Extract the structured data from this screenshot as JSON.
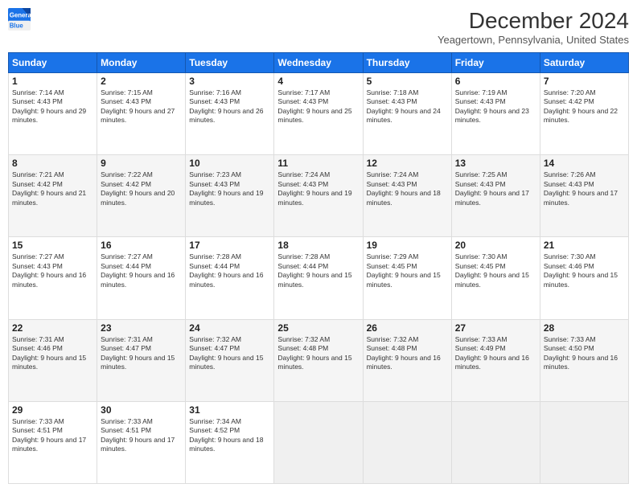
{
  "logo": {
    "general": "General",
    "blue": "Blue"
  },
  "title": "December 2024",
  "location": "Yeagertown, Pennsylvania, United States",
  "days_of_week": [
    "Sunday",
    "Monday",
    "Tuesday",
    "Wednesday",
    "Thursday",
    "Friday",
    "Saturday"
  ],
  "weeks": [
    [
      {
        "day": "1",
        "sunrise": "7:14 AM",
        "sunset": "4:43 PM",
        "daylight": "9 hours and 29 minutes."
      },
      {
        "day": "2",
        "sunrise": "7:15 AM",
        "sunset": "4:43 PM",
        "daylight": "9 hours and 27 minutes."
      },
      {
        "day": "3",
        "sunrise": "7:16 AM",
        "sunset": "4:43 PM",
        "daylight": "9 hours and 26 minutes."
      },
      {
        "day": "4",
        "sunrise": "7:17 AM",
        "sunset": "4:43 PM",
        "daylight": "9 hours and 25 minutes."
      },
      {
        "day": "5",
        "sunrise": "7:18 AM",
        "sunset": "4:43 PM",
        "daylight": "9 hours and 24 minutes."
      },
      {
        "day": "6",
        "sunrise": "7:19 AM",
        "sunset": "4:43 PM",
        "daylight": "9 hours and 23 minutes."
      },
      {
        "day": "7",
        "sunrise": "7:20 AM",
        "sunset": "4:42 PM",
        "daylight": "9 hours and 22 minutes."
      }
    ],
    [
      {
        "day": "8",
        "sunrise": "7:21 AM",
        "sunset": "4:42 PM",
        "daylight": "9 hours and 21 minutes."
      },
      {
        "day": "9",
        "sunrise": "7:22 AM",
        "sunset": "4:42 PM",
        "daylight": "9 hours and 20 minutes."
      },
      {
        "day": "10",
        "sunrise": "7:23 AM",
        "sunset": "4:43 PM",
        "daylight": "9 hours and 19 minutes."
      },
      {
        "day": "11",
        "sunrise": "7:24 AM",
        "sunset": "4:43 PM",
        "daylight": "9 hours and 19 minutes."
      },
      {
        "day": "12",
        "sunrise": "7:24 AM",
        "sunset": "4:43 PM",
        "daylight": "9 hours and 18 minutes."
      },
      {
        "day": "13",
        "sunrise": "7:25 AM",
        "sunset": "4:43 PM",
        "daylight": "9 hours and 17 minutes."
      },
      {
        "day": "14",
        "sunrise": "7:26 AM",
        "sunset": "4:43 PM",
        "daylight": "9 hours and 17 minutes."
      }
    ],
    [
      {
        "day": "15",
        "sunrise": "7:27 AM",
        "sunset": "4:43 PM",
        "daylight": "9 hours and 16 minutes."
      },
      {
        "day": "16",
        "sunrise": "7:27 AM",
        "sunset": "4:44 PM",
        "daylight": "9 hours and 16 minutes."
      },
      {
        "day": "17",
        "sunrise": "7:28 AM",
        "sunset": "4:44 PM",
        "daylight": "9 hours and 16 minutes."
      },
      {
        "day": "18",
        "sunrise": "7:28 AM",
        "sunset": "4:44 PM",
        "daylight": "9 hours and 15 minutes."
      },
      {
        "day": "19",
        "sunrise": "7:29 AM",
        "sunset": "4:45 PM",
        "daylight": "9 hours and 15 minutes."
      },
      {
        "day": "20",
        "sunrise": "7:30 AM",
        "sunset": "4:45 PM",
        "daylight": "9 hours and 15 minutes."
      },
      {
        "day": "21",
        "sunrise": "7:30 AM",
        "sunset": "4:46 PM",
        "daylight": "9 hours and 15 minutes."
      }
    ],
    [
      {
        "day": "22",
        "sunrise": "7:31 AM",
        "sunset": "4:46 PM",
        "daylight": "9 hours and 15 minutes."
      },
      {
        "day": "23",
        "sunrise": "7:31 AM",
        "sunset": "4:47 PM",
        "daylight": "9 hours and 15 minutes."
      },
      {
        "day": "24",
        "sunrise": "7:32 AM",
        "sunset": "4:47 PM",
        "daylight": "9 hours and 15 minutes."
      },
      {
        "day": "25",
        "sunrise": "7:32 AM",
        "sunset": "4:48 PM",
        "daylight": "9 hours and 15 minutes."
      },
      {
        "day": "26",
        "sunrise": "7:32 AM",
        "sunset": "4:48 PM",
        "daylight": "9 hours and 16 minutes."
      },
      {
        "day": "27",
        "sunrise": "7:33 AM",
        "sunset": "4:49 PM",
        "daylight": "9 hours and 16 minutes."
      },
      {
        "day": "28",
        "sunrise": "7:33 AM",
        "sunset": "4:50 PM",
        "daylight": "9 hours and 16 minutes."
      }
    ],
    [
      {
        "day": "29",
        "sunrise": "7:33 AM",
        "sunset": "4:51 PM",
        "daylight": "9 hours and 17 minutes."
      },
      {
        "day": "30",
        "sunrise": "7:33 AM",
        "sunset": "4:51 PM",
        "daylight": "9 hours and 17 minutes."
      },
      {
        "day": "31",
        "sunrise": "7:34 AM",
        "sunset": "4:52 PM",
        "daylight": "9 hours and 18 minutes."
      },
      null,
      null,
      null,
      null
    ]
  ],
  "labels": {
    "sunrise": "Sunrise:",
    "sunset": "Sunset:",
    "daylight": "Daylight:"
  }
}
